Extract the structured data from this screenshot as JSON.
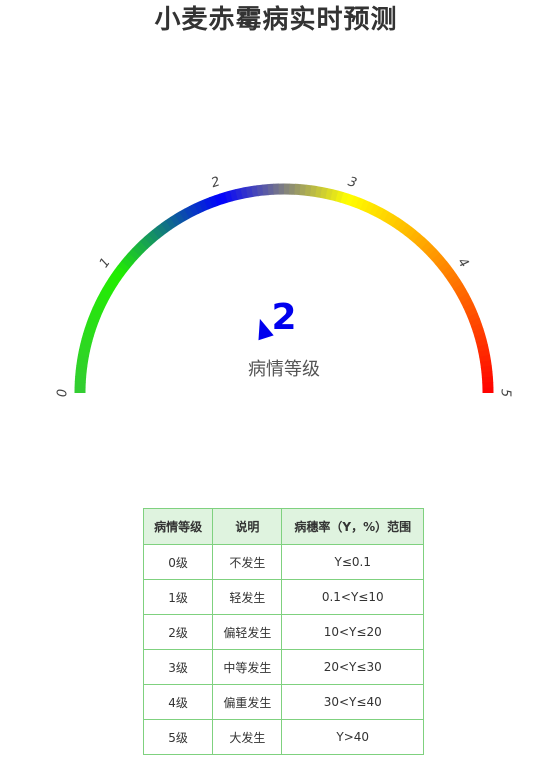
{
  "page": {
    "title": "小麦赤霉病实时预测"
  },
  "gauge": {
    "value": 2,
    "min": 0,
    "max": 5,
    "label": "病情等级",
    "tick_labels": [
      "0",
      "1",
      "2",
      "3",
      "4",
      "5"
    ],
    "segments": [
      {
        "from": 0,
        "to": 1,
        "color_start": "#33cc33",
        "color_end": "#22ee00"
      },
      {
        "from": 1,
        "to": 2,
        "color_start": "#22ee00",
        "color_end": "#0000ff"
      },
      {
        "from": 2,
        "to": 3,
        "color_start": "#0000ff",
        "color_end": "#ffff00"
      },
      {
        "from": 3,
        "to": 4,
        "color_start": "#ffff00",
        "color_end": "#ff8000"
      },
      {
        "from": 4,
        "to": 5,
        "color_start": "#ff8000",
        "color_end": "#ff0000"
      }
    ],
    "value_color": "#0000ee",
    "pointer_color": "#0000ee"
  },
  "table": {
    "headers": [
      "病情等级",
      "说明",
      "病穗率（Y，%）范围"
    ],
    "rows": [
      [
        "0级",
        "不发生",
        "Y≤0.1"
      ],
      [
        "1级",
        "轻发生",
        "0.1<Y≤10"
      ],
      [
        "2级",
        "偏轻发生",
        "10<Y≤20"
      ],
      [
        "3级",
        "中等发生",
        "20<Y≤30"
      ],
      [
        "4级",
        "偏重发生",
        "30<Y≤40"
      ],
      [
        "5级",
        "大发生",
        "Y>40"
      ]
    ]
  }
}
